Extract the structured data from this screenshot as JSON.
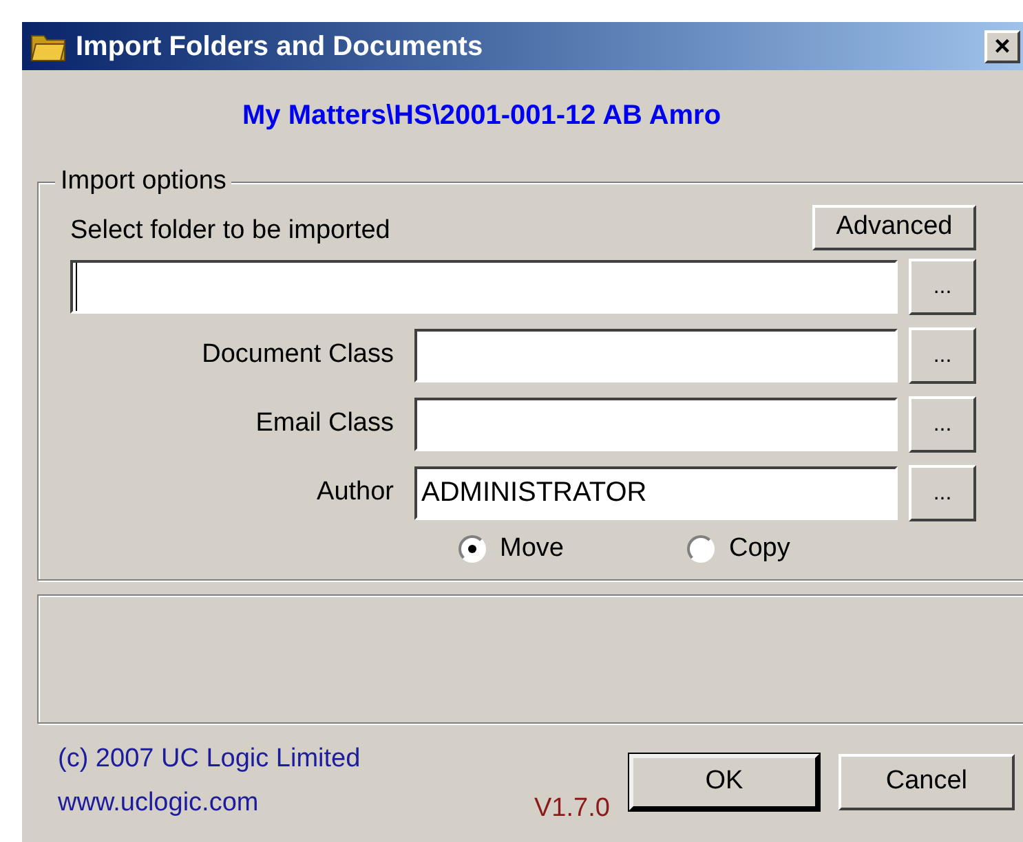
{
  "window": {
    "title": "Import Folders and Documents",
    "close": "×"
  },
  "matter_path": "My Matters\\HS\\2001-001-12 AB Amro",
  "import_options": {
    "legend": "Import options",
    "folder_label": "Select folder to be imported",
    "advanced_button": "Advanced",
    "folder_field": {
      "focused": true,
      "browse": "..."
    },
    "fields": [
      {
        "label": "Document Class",
        "browse": "..."
      },
      {
        "label": "Email Class",
        "browse": "..."
      },
      {
        "label": "Author",
        "value": "ADMINISTRATOR",
        "browse": "..."
      }
    ],
    "transfer": [
      {
        "label": "Move",
        "selected": true
      },
      {
        "label": "Copy",
        "selected": false
      }
    ]
  },
  "footer": {
    "copyright": "(c) 2007 UC Logic Limited",
    "website": "www.uclogic.com",
    "version": "V1.7.0",
    "buttons": [
      {
        "label": "OK",
        "default": true
      },
      {
        "label": "Cancel",
        "default": false
      }
    ]
  }
}
